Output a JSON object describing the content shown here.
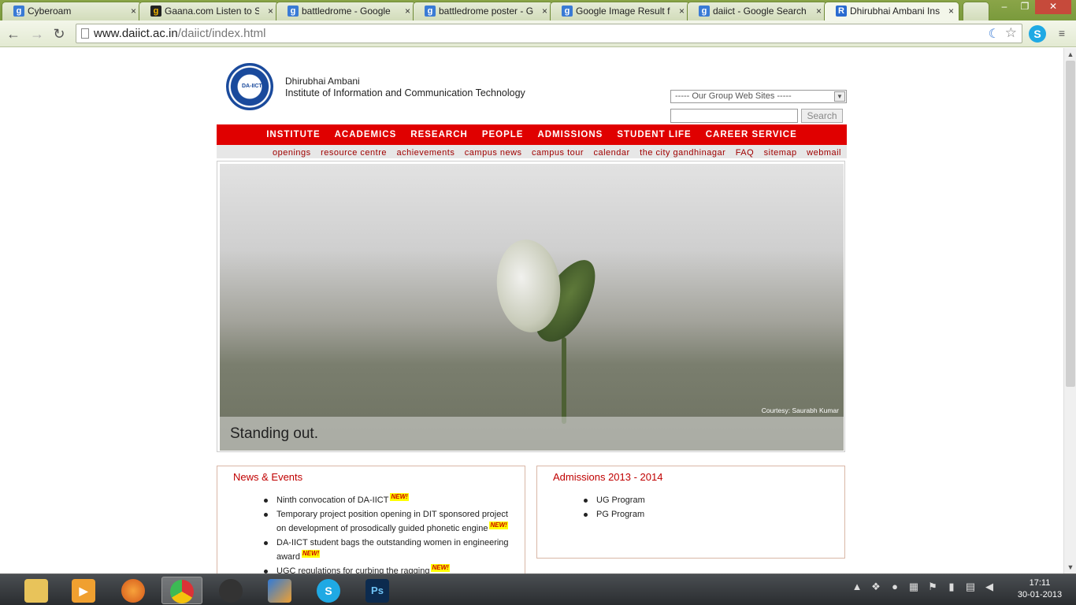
{
  "browser": {
    "tabs": [
      {
        "label": "Cyberoam",
        "favicon": "google-icon"
      },
      {
        "label": "Gaana.com Listen to S",
        "favicon": "gaana-icon"
      },
      {
        "label": "battledrome - Google",
        "favicon": "google-icon"
      },
      {
        "label": "battledrome poster - G",
        "favicon": "google-icon"
      },
      {
        "label": "Google Image Result f",
        "favicon": "google-icon"
      },
      {
        "label": "daiict - Google Search",
        "favicon": "google-icon"
      },
      {
        "label": "Dhirubhai Ambani Ins",
        "favicon": "daiict-icon"
      }
    ],
    "close_glyph": "×",
    "url_host": "www.daiict.ac.in",
    "url_path": "/daiict/index.html"
  },
  "site": {
    "logo_text": "DA-IICT",
    "inst_line1": "Dhirubhai Ambani",
    "inst_line2": "Institute of Information and Communication Technology",
    "group_select": "----- Our Group Web Sites -----",
    "search_button": "Search",
    "main_nav": [
      "INSTITUTE",
      "ACADEMICS",
      "RESEARCH",
      "PEOPLE",
      "ADMISSIONS",
      "STUDENT LIFE",
      "CAREER SERVICE"
    ],
    "sub_nav": [
      "openings",
      "resource centre",
      "achievements",
      "campus news",
      "campus tour",
      "calendar",
      "the city gandhinagar",
      "FAQ",
      "sitemap",
      "webmail"
    ],
    "hero_credit": "Courtesy: Saurabh Kumar",
    "hero_caption": "Standing out.",
    "news": {
      "title": "News & Events",
      "new_badge": "NEW!",
      "items": [
        "Ninth convocation of DA-IICT",
        "Temporary project position opening in DIT sponsored project on development of prosodically guided phonetic engine",
        "DA-IICT student bags the outstanding women in engineering award",
        "UGC regulations for curbing the ragging"
      ]
    },
    "admissions": {
      "title": "Admissions 2013 - 2014",
      "items": [
        "UG Program",
        "PG Program"
      ]
    }
  },
  "taskbar": {
    "apps": [
      "explorer-icon",
      "media-player-icon",
      "firefox-icon",
      "chrome-icon",
      "app-icon",
      "app2-icon",
      "skype-icon",
      "photoshop-icon"
    ],
    "ps_label": "Ps",
    "time": "17:11",
    "date": "30-01-2013"
  },
  "colors": {
    "nav_red": "#e00000",
    "heading_red": "#c00000",
    "chrome_green": "#8aa548"
  }
}
